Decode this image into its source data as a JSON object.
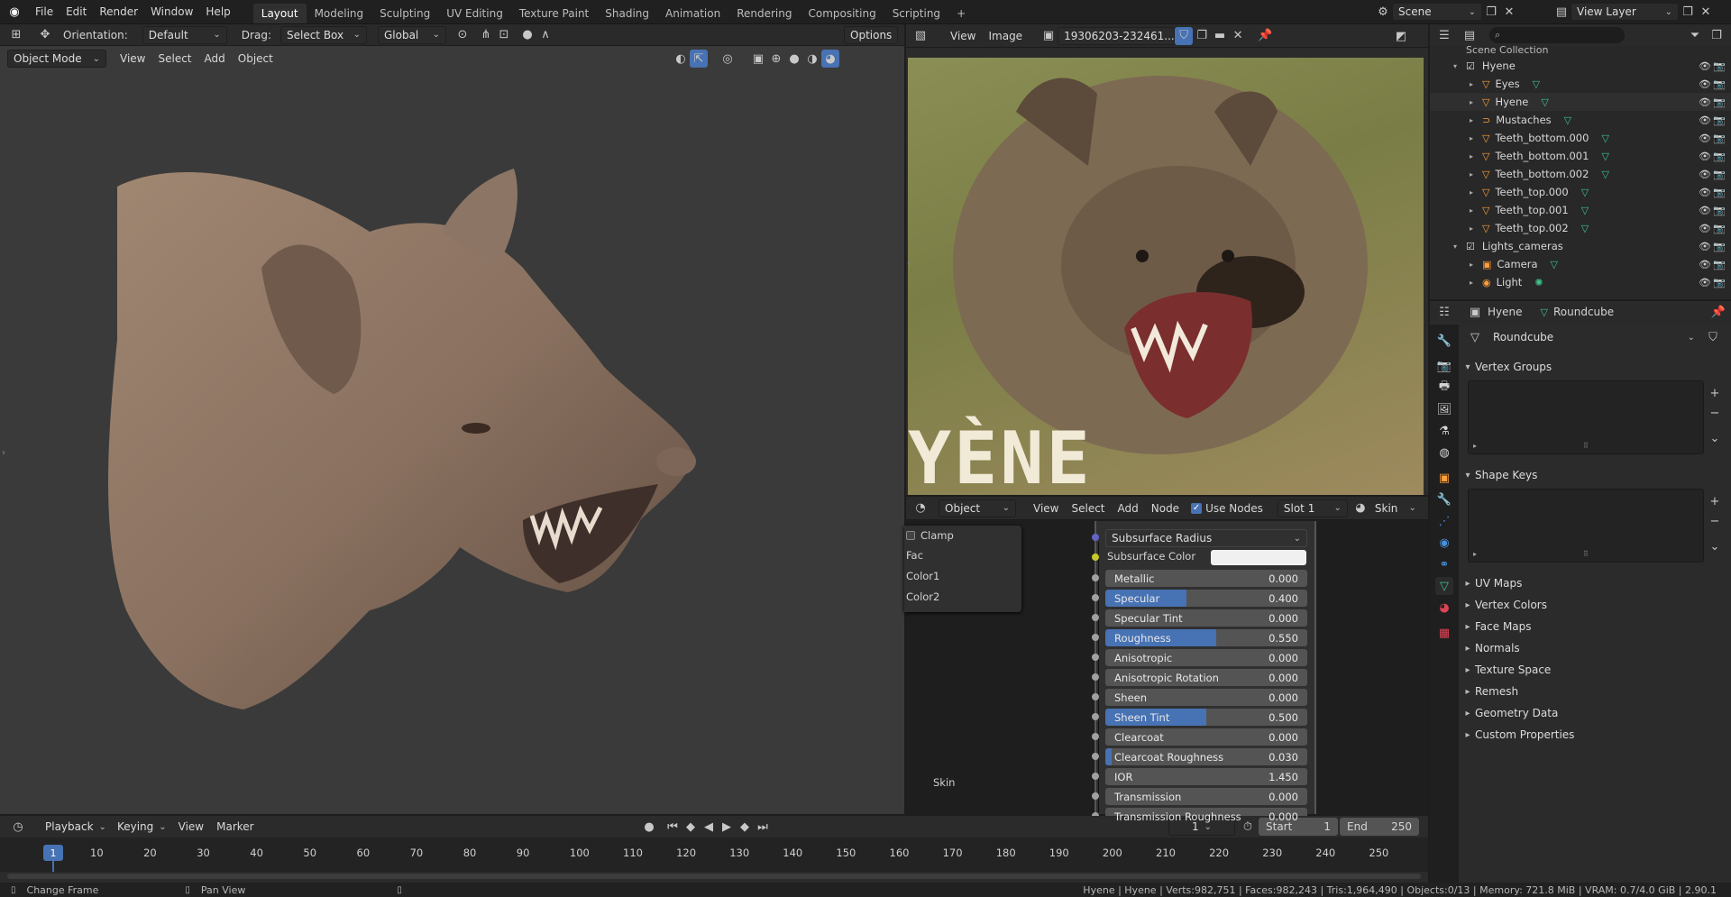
{
  "topbar": {
    "menus": [
      "File",
      "Edit",
      "Render",
      "Window",
      "Help"
    ],
    "workspaces": [
      "Layout",
      "Modeling",
      "Sculpting",
      "UV Editing",
      "Texture Paint",
      "Shading",
      "Animation",
      "Rendering",
      "Compositing",
      "Scripting"
    ],
    "active_workspace": "Layout",
    "add_tab": "+",
    "scene": "Scene",
    "view_layer": "View Layer"
  },
  "viewport": {
    "orientation_label": "Orientation:",
    "orientation_value": "Default",
    "drag_label": "Drag:",
    "drag_value": "Select Box",
    "transform_value": "Global",
    "options": "Options",
    "mode": "Object Mode",
    "menus": [
      "View",
      "Select",
      "Add",
      "Object"
    ]
  },
  "image_editor": {
    "menus": [
      "View",
      "Image"
    ],
    "image_name": "19306203-232461...",
    "image_text": "YÈNE"
  },
  "node_editor": {
    "object_value": "Object",
    "menus": [
      "View",
      "Select",
      "Add",
      "Node"
    ],
    "use_nodes": "Use Nodes",
    "slot": "Slot 1",
    "material": "Skin",
    "mix_node": {
      "clamp": "Clamp",
      "inputs": [
        "Fac",
        "Color1",
        "Color2"
      ]
    },
    "frame_label": "Skin",
    "subsurface_radius": "Subsurface Radius",
    "subsurface_color": "Subsurface Color",
    "params": [
      {
        "label": "Metallic",
        "value": "0.000",
        "fill": 0
      },
      {
        "label": "Specular",
        "value": "0.400",
        "fill": 0.4
      },
      {
        "label": "Specular Tint",
        "value": "0.000",
        "fill": 0
      },
      {
        "label": "Roughness",
        "value": "0.550",
        "fill": 0.55
      },
      {
        "label": "Anisotropic",
        "value": "0.000",
        "fill": 0
      },
      {
        "label": "Anisotropic Rotation",
        "value": "0.000",
        "fill": 0
      },
      {
        "label": "Sheen",
        "value": "0.000",
        "fill": 0
      },
      {
        "label": "Sheen Tint",
        "value": "0.500",
        "fill": 0.5
      },
      {
        "label": "Clearcoat",
        "value": "0.000",
        "fill": 0
      },
      {
        "label": "Clearcoat Roughness",
        "value": "0.030",
        "fill": 0.03
      },
      {
        "label": "IOR",
        "value": "1.450",
        "fill": 0
      },
      {
        "label": "Transmission",
        "value": "0.000",
        "fill": 0
      },
      {
        "label": "Transmission Roughness",
        "value": "0.000",
        "fill": 0
      }
    ]
  },
  "outliner": {
    "search_placeholder": "",
    "root": "Scene Collection",
    "items": [
      {
        "label": "Hyene",
        "type": "collection",
        "level": 1
      },
      {
        "label": "Eyes",
        "type": "object",
        "level": 2
      },
      {
        "label": "Hyene",
        "type": "object",
        "level": 2
      },
      {
        "label": "Mustaches",
        "type": "curve",
        "level": 2
      },
      {
        "label": "Teeth_bottom.000",
        "type": "object",
        "level": 2
      },
      {
        "label": "Teeth_bottom.001",
        "type": "object",
        "level": 2
      },
      {
        "label": "Teeth_bottom.002",
        "type": "object",
        "level": 2
      },
      {
        "label": "Teeth_top.000",
        "type": "object",
        "level": 2
      },
      {
        "label": "Teeth_top.001",
        "type": "object",
        "level": 2
      },
      {
        "label": "Teeth_top.002",
        "type": "object",
        "level": 2
      },
      {
        "label": "Lights_cameras",
        "type": "collection",
        "level": 1
      },
      {
        "label": "Camera",
        "type": "camera",
        "level": 2
      },
      {
        "label": "Light",
        "type": "light",
        "level": 2
      }
    ]
  },
  "properties": {
    "breadcrumb_object": "Hyene",
    "breadcrumb_data": "Roundcube",
    "mesh_name": "Roundcube",
    "panels_open": [
      "Vertex Groups",
      "Shape Keys"
    ],
    "panels_closed": [
      "UV Maps",
      "Vertex Colors",
      "Face Maps",
      "Normals",
      "Texture Space",
      "Remesh",
      "Geometry Data",
      "Custom Properties"
    ]
  },
  "timeline": {
    "menus": [
      "Playback",
      "Keying",
      "View",
      "Marker"
    ],
    "current_frame": "1",
    "start_label": "Start",
    "start": "1",
    "end_label": "End",
    "end": "250",
    "ticks": [
      "10",
      "20",
      "30",
      "40",
      "50",
      "60",
      "70",
      "80",
      "90",
      "100",
      "110",
      "120",
      "130",
      "140",
      "150",
      "160",
      "170",
      "180",
      "190",
      "200",
      "210",
      "220",
      "230",
      "240",
      "250"
    ]
  },
  "statusbar": {
    "left": "Change Frame",
    "middle": "Pan View",
    "right": "Hyene | Hyene | Verts:982,751 | Faces:982,243 | Tris:1,964,490 | Objects:0/13 | Memory: 721.8 MiB | VRAM: 0.7/4.0 GiB | 2.90.1"
  },
  "colors": {
    "accent": "#4772b3",
    "object_orange": "#ff9e3a",
    "data_green": "#3ec38b"
  }
}
